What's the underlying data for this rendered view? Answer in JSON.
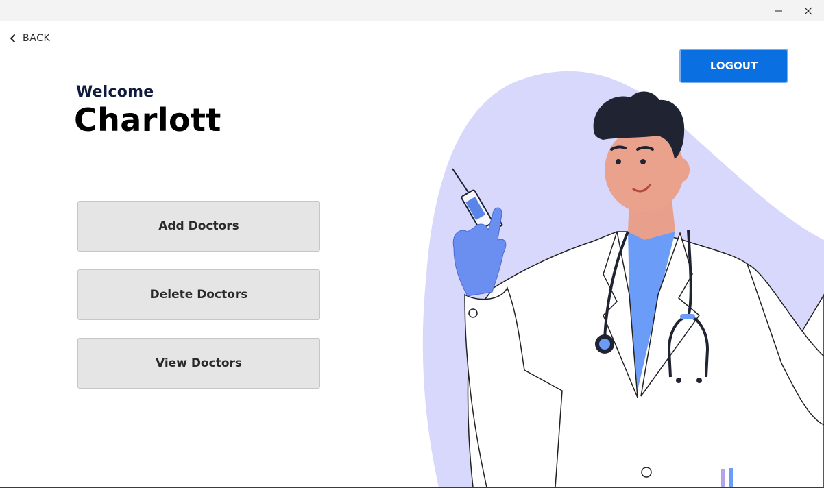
{
  "window": {
    "minimize_icon": "minimize-icon",
    "close_icon": "close-icon"
  },
  "nav": {
    "back_label": "BACK",
    "back_icon": "chevron-left-icon"
  },
  "greeting": {
    "welcome": "Welcome",
    "name": "Charlott"
  },
  "menu": {
    "add_label": "Add Doctors",
    "delete_label": "Delete Doctors",
    "view_label": "View Doctors"
  },
  "header": {
    "logout_label": "LOGOUT"
  },
  "colors": {
    "accent": "#0a6fe0",
    "blob": "#d8d7fc",
    "button_bg": "#e5e5e5",
    "scrub": "#6b9cf7",
    "glove": "#6b8ff0"
  },
  "illustration": {
    "icon": "doctor-with-syringe-illustration"
  }
}
